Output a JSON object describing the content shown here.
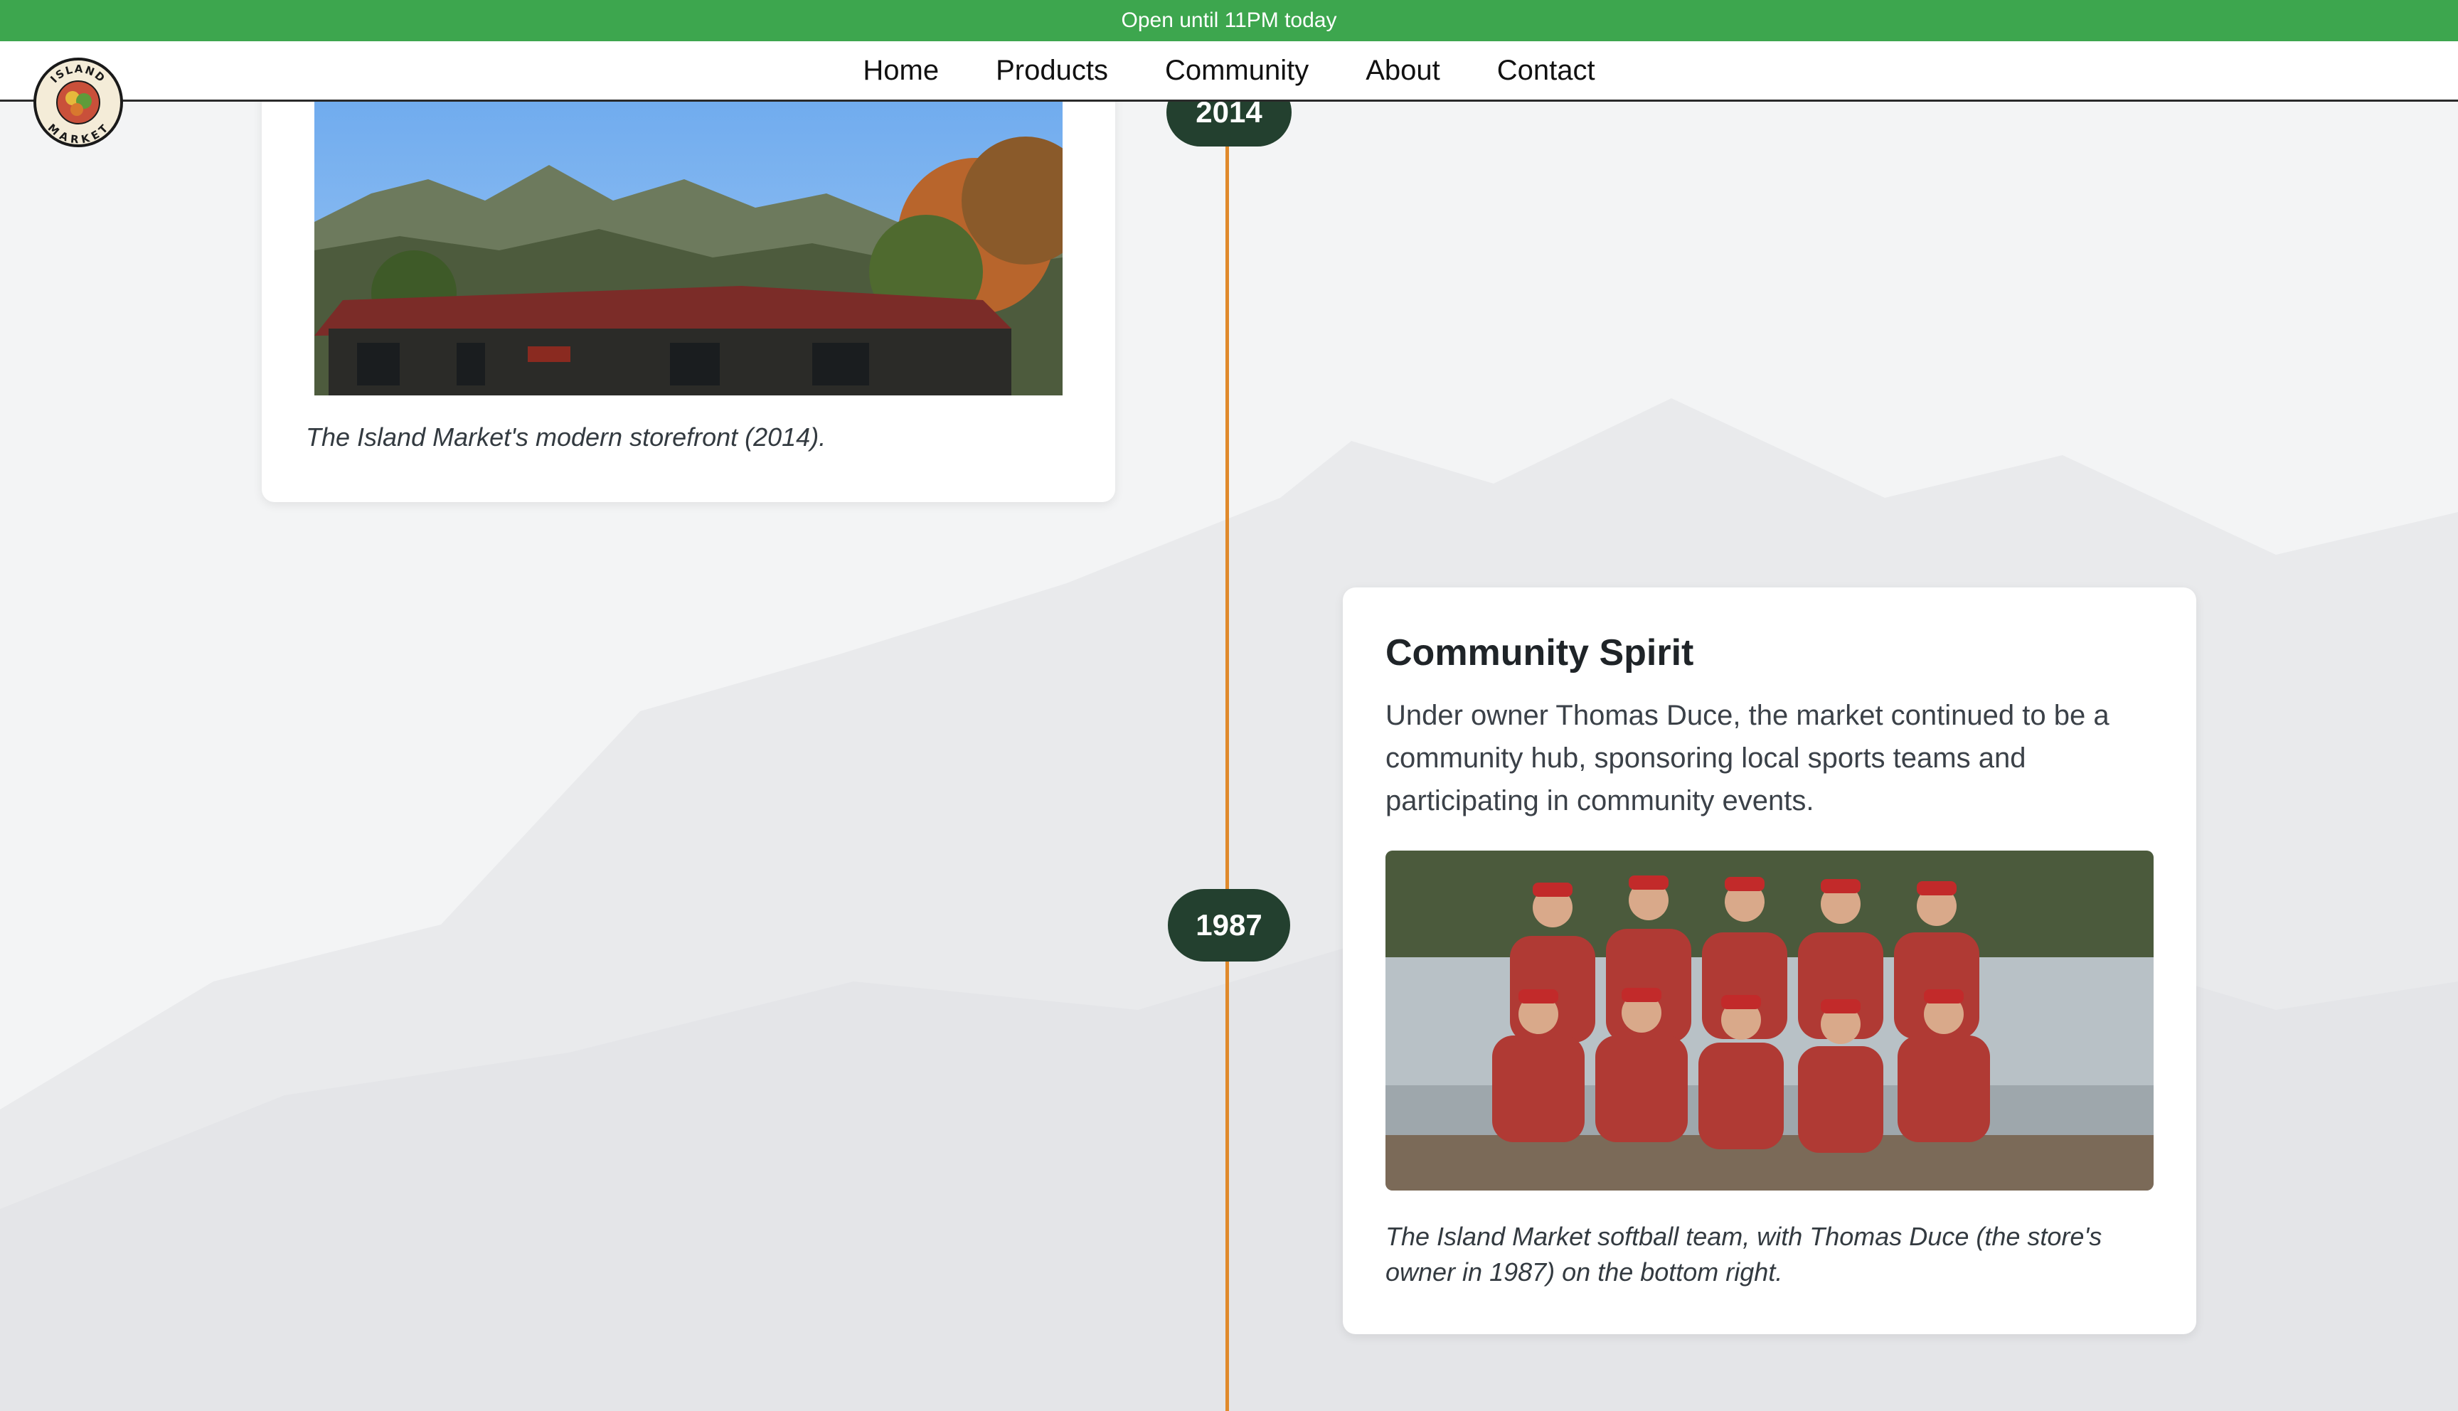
{
  "banner": {
    "text": "Open until 11PM today"
  },
  "nav": {
    "logo_text_top": "ISLAND",
    "logo_text_bottom": "MARKET",
    "items": [
      {
        "label": "Home"
      },
      {
        "label": "Products"
      },
      {
        "label": "Community"
      },
      {
        "label": "About"
      },
      {
        "label": "Contact"
      }
    ]
  },
  "timeline": {
    "accent_color": "#e08a2c",
    "pill_color": "#23402f",
    "entries": [
      {
        "year": "2014",
        "caption": "The Island Market's modern storefront (2014)."
      },
      {
        "year": "1987",
        "title": "Community Spirit",
        "body": "Under owner Thomas Duce, the market continued to be a community hub, sponsoring local sports teams and participating in community events.",
        "caption": "The Island Market softball team, with Thomas Duce (the store's owner in 1987) on the bottom right."
      }
    ]
  },
  "colors": {
    "banner": "#3da64e",
    "page_bg": "#f3f4f5",
    "card_bg": "#ffffff"
  }
}
